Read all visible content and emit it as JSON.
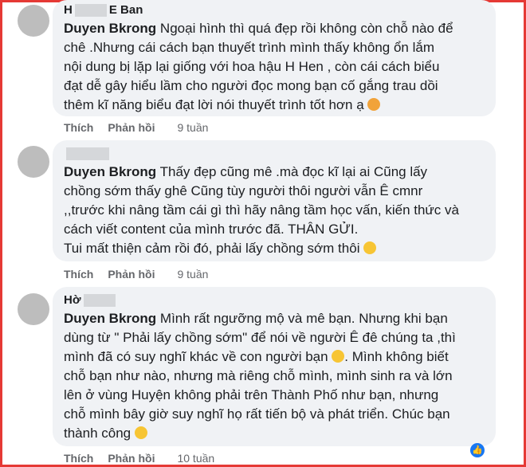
{
  "comments": [
    {
      "author_prefix": "H",
      "author_suffix": "E Ban",
      "mention": "Duyen Bkrong",
      "lines": [
        "Ngoại hình thì quá đẹp rồi không còn chỗ nào để",
        "chê .Nhưng cái cách bạn thuyết trình mình thấy không ổn lắm",
        "nội dung bị lặp lại giống với hoa hậu H Hen , còn cái cách biểu",
        "đạt dễ gây hiểu lầm cho người đọc mong bạn cố gắng trau dồi",
        "thêm kĩ năng biểu đạt lời nói thuyết trình tốt hơn ạ"
      ],
      "emoji": "hearts-face-icon",
      "like": "Thích",
      "reply": "Phản hồi",
      "time": "9 tuần"
    },
    {
      "author_prefix": "",
      "author_suffix": "",
      "mention": "Duyen Bkrong",
      "lines": [
        "Thấy đẹp cũng mê .mà đọc kĩ lại ai Cũng lấy",
        "chồng sớm thấy ghê Cũng tùy người thôi người vẫn Ê cmnr",
        ",,trước khi nâng tầm cái gì thì hãy nâng tầm học vấn, kiến thức và",
        "cách viết content của mình trước đã. THÂN GỬI.",
        "Tui mất thiện cảm rồi đó, phải lấy chồng sớm thôi"
      ],
      "emoji": "sweat-smile-icon",
      "like": "Thích",
      "reply": "Phản hồi",
      "time": "9 tuần"
    },
    {
      "author_prefix": "Hờ",
      "author_suffix": "",
      "mention": "Duyen Bkrong",
      "lines": [
        "Mình rất ngưỡng mộ và mê bạn. Nhưng khi bạn",
        "dùng từ \" Phải lấy chồng sớm\" để nói về người Ê đê chúng ta ,thì",
        "mình đã có suy nghĩ khác về con người bạn",
        "chỗ bạn như nào, nhưng mà riêng chỗ mình, mình sinh ra và lớn",
        "lên ở vùng Huyện không phải trên Thành Phố như bạn, nhưng",
        "chỗ mình bây giờ suy nghĩ họ rất tiến bộ và phát triển. Chúc bạn",
        "thành công"
      ],
      "line3_tail": ". Mình không biết",
      "emoji": "smile-icon",
      "like": "Thích",
      "reply": "Phản hồi",
      "time": "10 tuần"
    }
  ]
}
